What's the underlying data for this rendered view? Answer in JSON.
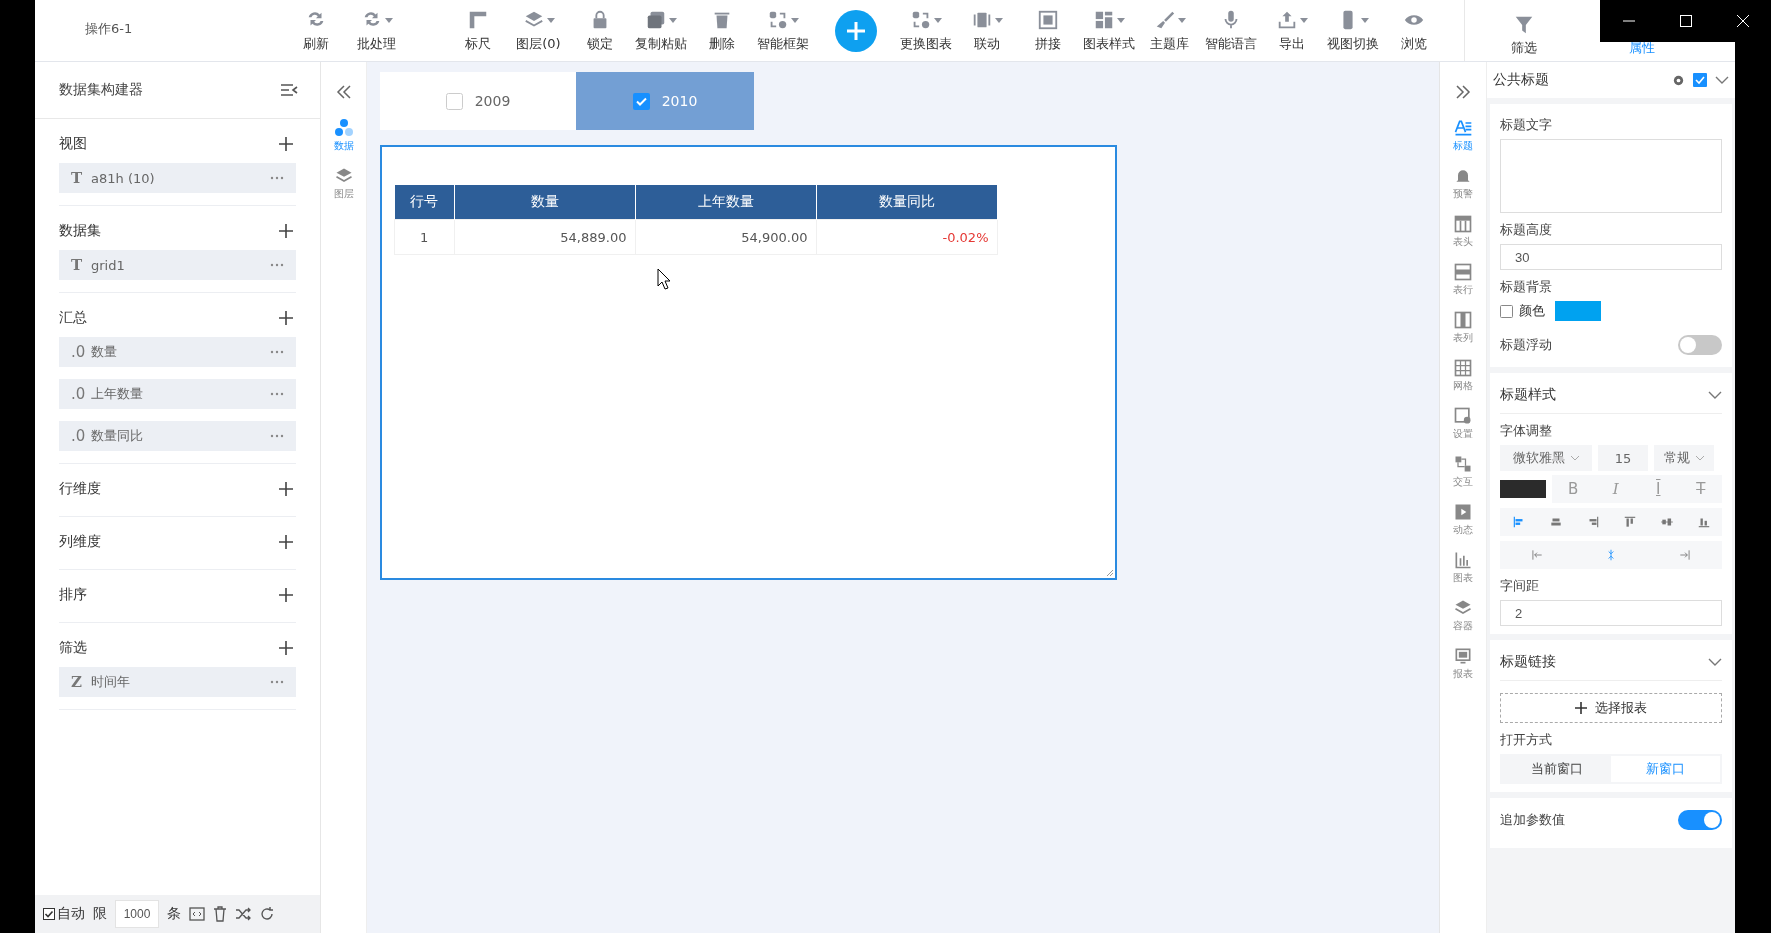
{
  "window": {
    "title": "操作6-1"
  },
  "toolbar_left": [
    {
      "label": "刷新",
      "dropdown": false
    },
    {
      "label": "批处理",
      "dropdown": true
    }
  ],
  "toolbar_mid": [
    {
      "label": "标尺",
      "dropdown": false
    },
    {
      "label": "图层(0)",
      "dropdown": true
    },
    {
      "label": "锁定",
      "dropdown": false
    },
    {
      "label": "复制粘贴",
      "dropdown": true
    },
    {
      "label": "删除",
      "dropdown": false
    },
    {
      "label": "智能框架",
      "dropdown": true
    }
  ],
  "toolbar_right": [
    {
      "label": "更换图表",
      "dropdown": true
    },
    {
      "label": "联动",
      "dropdown": true
    },
    {
      "label": "拼接",
      "dropdown": false
    },
    {
      "label": "图表样式",
      "dropdown": true
    },
    {
      "label": "主题库",
      "dropdown": true
    },
    {
      "label": "智能语言",
      "dropdown": false
    },
    {
      "label": "导出",
      "dropdown": true
    },
    {
      "label": "视图切换",
      "dropdown": true
    },
    {
      "label": "浏览",
      "dropdown": false
    }
  ],
  "panel_tabs": [
    {
      "label": "筛选",
      "selected": false
    },
    {
      "label": "属性",
      "selected": true
    }
  ],
  "builder": {
    "title": "数据集构建器",
    "sections": [
      {
        "title": "视图",
        "fields": [
          {
            "type_mark": "T",
            "name": "a81h (10)"
          }
        ]
      },
      {
        "title": "数据集",
        "fields": [
          {
            "type_mark": "T",
            "name": "grid1"
          }
        ]
      },
      {
        "title": "汇总",
        "fields": [
          {
            "type_mark": ".0",
            "name": "数量"
          },
          {
            "type_mark": ".0",
            "name": "上年数量"
          },
          {
            "type_mark": ".0",
            "name": "数量同比"
          }
        ]
      },
      {
        "title": "行维度"
      },
      {
        "title": "列维度"
      },
      {
        "title": "排序"
      },
      {
        "title": "筛选",
        "fields": [
          {
            "type_mark": "Z",
            "name": "时间年"
          }
        ]
      }
    ],
    "bottom": {
      "auto_label": "自动",
      "auto_checked": true,
      "limit_label": "限",
      "limit_value": "1000",
      "unit": "条"
    }
  },
  "left_nav": [
    {
      "label": "数据",
      "selected": true
    },
    {
      "label": "图层",
      "selected": false
    }
  ],
  "filter_tabs": [
    {
      "label": "2009",
      "selected": false
    },
    {
      "label": "2010",
      "selected": true
    }
  ],
  "table": {
    "columns": [
      "行号",
      "数量",
      "上年数量",
      "数量同比"
    ],
    "rows": [
      {
        "cells": [
          "1",
          "54,889.00",
          "54,900.00",
          "-0.02%"
        ],
        "change_negative": true
      }
    ]
  },
  "right_nav": [
    {
      "label": "标题",
      "selected": true
    },
    {
      "label": "预警",
      "selected": false
    },
    {
      "label": "表头",
      "selected": false
    },
    {
      "label": "表行",
      "selected": false
    },
    {
      "label": "表列",
      "selected": false
    },
    {
      "label": "网格",
      "selected": false
    },
    {
      "label": "设置",
      "selected": false
    },
    {
      "label": "交互",
      "selected": false
    },
    {
      "label": "动态",
      "selected": false
    },
    {
      "label": "图表",
      "selected": false
    },
    {
      "label": "容器",
      "selected": false
    },
    {
      "label": "报表",
      "selected": false
    }
  ],
  "props": {
    "title": "公共标题",
    "enabled": true,
    "title_text_label": "标题文字",
    "height_label": "标题高度",
    "height_value": "30",
    "bg_label": "标题背景",
    "bg_color_label": "颜色",
    "bg_color_checked": false,
    "float_label": "标题浮动",
    "float_on": false,
    "style_section": {
      "title": "标题样式",
      "expanded": true,
      "font_label": "字体调整",
      "font_family": "微软雅黑",
      "font_size": "15",
      "font_weight": "常规",
      "format_buttons": [
        {
          "label": "B",
          "kind": "bold"
        },
        {
          "label": "I",
          "kind": "italic"
        },
        {
          "label": "I",
          "kind": "underline"
        },
        {
          "label": "T",
          "kind": "strike"
        }
      ],
      "align": [
        {
          "selected": true
        },
        {
          "selected": false
        },
        {
          "selected": false
        },
        {
          "selected": false
        },
        {
          "selected": false
        },
        {
          "selected": false
        }
      ],
      "indent": [
        {
          "selected": false
        },
        {
          "selected": true
        },
        {
          "selected": false
        }
      ],
      "spacing_label": "字间距",
      "spacing_value": "2"
    },
    "link_section": {
      "title": "标题链接",
      "expanded": true,
      "choose_label": "选择报表",
      "open_label": "打开方式",
      "open_options": [
        {
          "label": "当前窗口",
          "selected": false
        },
        {
          "label": "新窗口",
          "selected": true
        }
      ]
    },
    "param_label": "追加参数值",
    "param_on": true
  }
}
